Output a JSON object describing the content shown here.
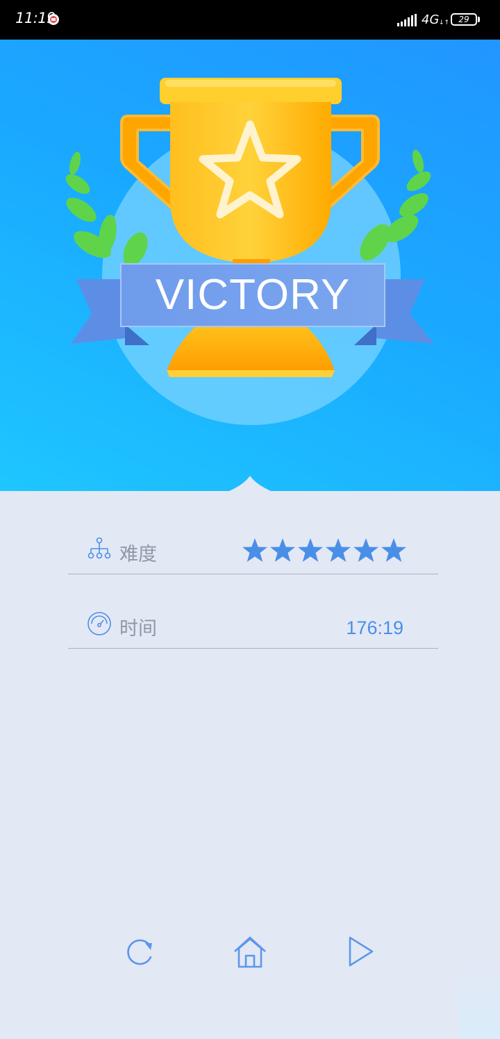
{
  "status_bar": {
    "time": "11:19",
    "network": "4G",
    "network_arrows": "↓↑",
    "battery": "29"
  },
  "banner": {
    "text": "VICTORY"
  },
  "stats": {
    "difficulty_label": "难度",
    "difficulty_stars": 6,
    "time_label": "时间",
    "time_value": "176:19"
  },
  "actions": {
    "restart": "refresh-icon",
    "home": "home-icon",
    "next": "play-icon"
  },
  "colors": {
    "accent": "#4a8fe7",
    "hero_top": "#2196ff",
    "hero_bottom": "#1ec6ff",
    "trophy": "#ffb000",
    "panel_bg": "#e3e8f5"
  }
}
